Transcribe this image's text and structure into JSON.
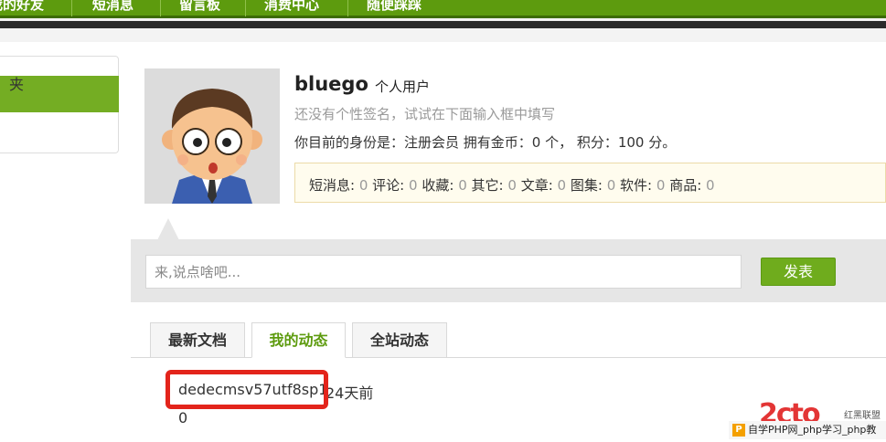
{
  "nav": {
    "items": [
      "我的好友",
      "短消息",
      "留言板",
      "消费中心",
      "随便踩踩"
    ]
  },
  "sidebar": {
    "item_2": "夹"
  },
  "user": {
    "name": "bluego",
    "type": "个人用户",
    "signature": "还没有个性签名，试试在下面输入框中填写",
    "identity": "你目前的身份是：注册会员 拥有金币：0 个， 积分：100 分。"
  },
  "stats": [
    {
      "label": "短消息:",
      "value": "0"
    },
    {
      "label": "评论:",
      "value": "0"
    },
    {
      "label": "收藏:",
      "value": "0"
    },
    {
      "label": "其它:",
      "value": "0"
    },
    {
      "label": "文章:",
      "value": "0"
    },
    {
      "label": "图集:",
      "value": "0"
    },
    {
      "label": "软件:",
      "value": "0"
    },
    {
      "label": "商品:",
      "value": "0"
    }
  ],
  "post": {
    "placeholder": "来,说点啥吧...",
    "button": "发表"
  },
  "tabs": [
    "最新文档",
    "我的动态",
    "全站动态"
  ],
  "feed": {
    "link": "dedecmsv57utf8sp1",
    "time": "24天前",
    "count": "0"
  },
  "watermark": {
    "logo": "2cto",
    "right": "红黑联盟",
    "bottom": "自学PHP网_php学习_php教"
  },
  "colors": {
    "nav_green": "#5d9b0e",
    "button_green": "#6fac1d",
    "highlight_red": "#e3241b"
  }
}
